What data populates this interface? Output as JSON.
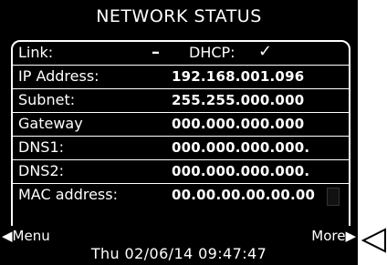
{
  "title": "NETWORK STATUS",
  "link": {
    "label": "Link:",
    "state": "–"
  },
  "dhcp": {
    "label": "DHCP:",
    "state": "✓"
  },
  "rows": [
    {
      "label": "IP Address:",
      "value": "192.168.001.096"
    },
    {
      "label": "Subnet:",
      "value": "255.255.000.000"
    },
    {
      "label": "Gateway",
      "value": "000.000.000.000"
    },
    {
      "label": "DNS1:",
      "value": "000.000.000.000."
    },
    {
      "label": "DNS2:",
      "value": "000.000.000.000."
    },
    {
      "label": "MAC address:",
      "value": "00.00.00.00.00.00"
    }
  ],
  "footer": {
    "menu": "◀Menu",
    "more": "More▶",
    "datetime": "Thu 02/06/14  09:47:47"
  },
  "icons": {
    "pointer": "outline-triangle-pointer-icon"
  },
  "colors": {
    "screen_bg": "#000000",
    "text": "#ffffff"
  }
}
